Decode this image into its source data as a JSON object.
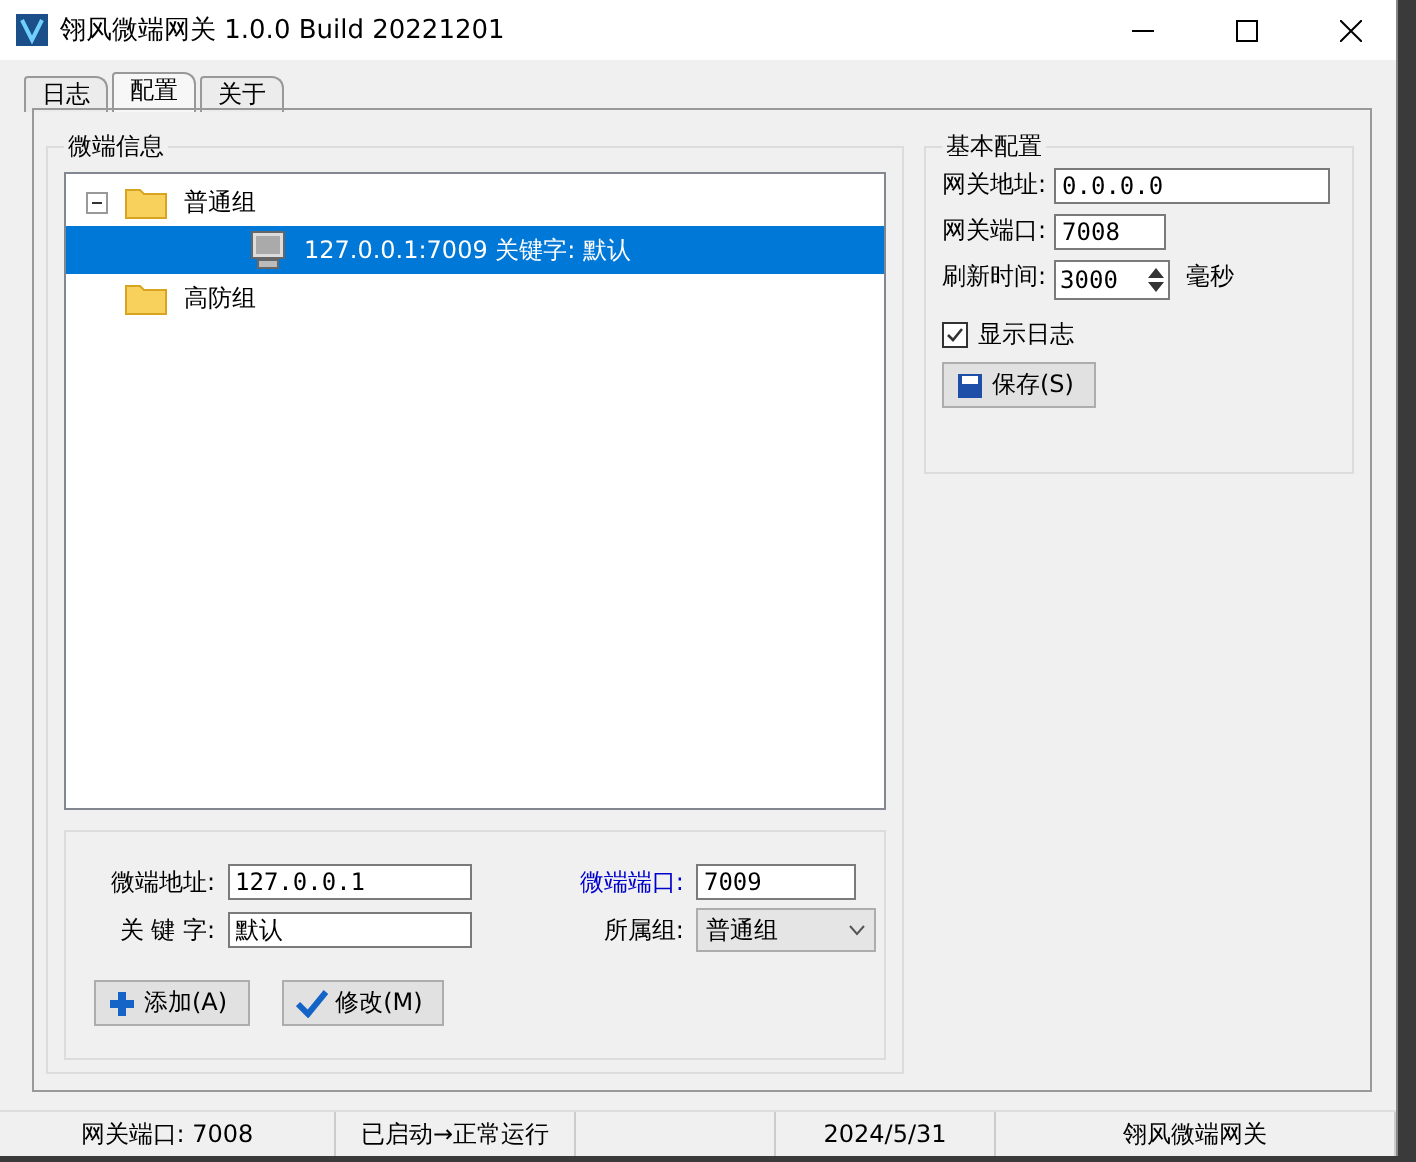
{
  "window": {
    "title": "翎风微端网关 1.0.0 Build 20221201"
  },
  "tabs": [
    {
      "label": "日志",
      "selected": false
    },
    {
      "label": "配置",
      "selected": true
    },
    {
      "label": "关于",
      "selected": false
    }
  ],
  "client_info": {
    "title": "微端信息",
    "tree": [
      {
        "label": "普通组",
        "kind": "folder",
        "expanded": true,
        "selected": false,
        "children": [
          {
            "label": "127.0.0.1:7009 关键字: 默认",
            "kind": "computer",
            "selected": true
          }
        ]
      },
      {
        "label": "高防组",
        "kind": "folder",
        "selected": false
      }
    ],
    "address": {
      "label": "微端地址:",
      "value": "127.0.0.1"
    },
    "port": {
      "label": "微端端口:",
      "value": "7009"
    },
    "keyword": {
      "label": "关 键 字:",
      "value": "默认"
    },
    "group": {
      "label": "所属组:",
      "value": "普通组"
    },
    "buttons": [
      {
        "label": "添加(A)",
        "kind": "add"
      },
      {
        "label": "修改(M)",
        "kind": "edit"
      }
    ]
  },
  "basic_config": {
    "title": "基本配置",
    "gateway_address": {
      "label": "网关地址:",
      "value": "0.0.0.0"
    },
    "gateway_port": {
      "label": "网关端口:",
      "value": "7008"
    },
    "refresh": {
      "label": "刷新时间:",
      "value": "3000",
      "unit": "毫秒"
    },
    "show_log": {
      "label": "显示日志",
      "checked": true
    },
    "save": {
      "label": "保存(S)"
    }
  },
  "status_bar": [
    "网关端口: 7008",
    "已启动→正常运行",
    "2024/5/31",
    "翎风微端网关"
  ]
}
